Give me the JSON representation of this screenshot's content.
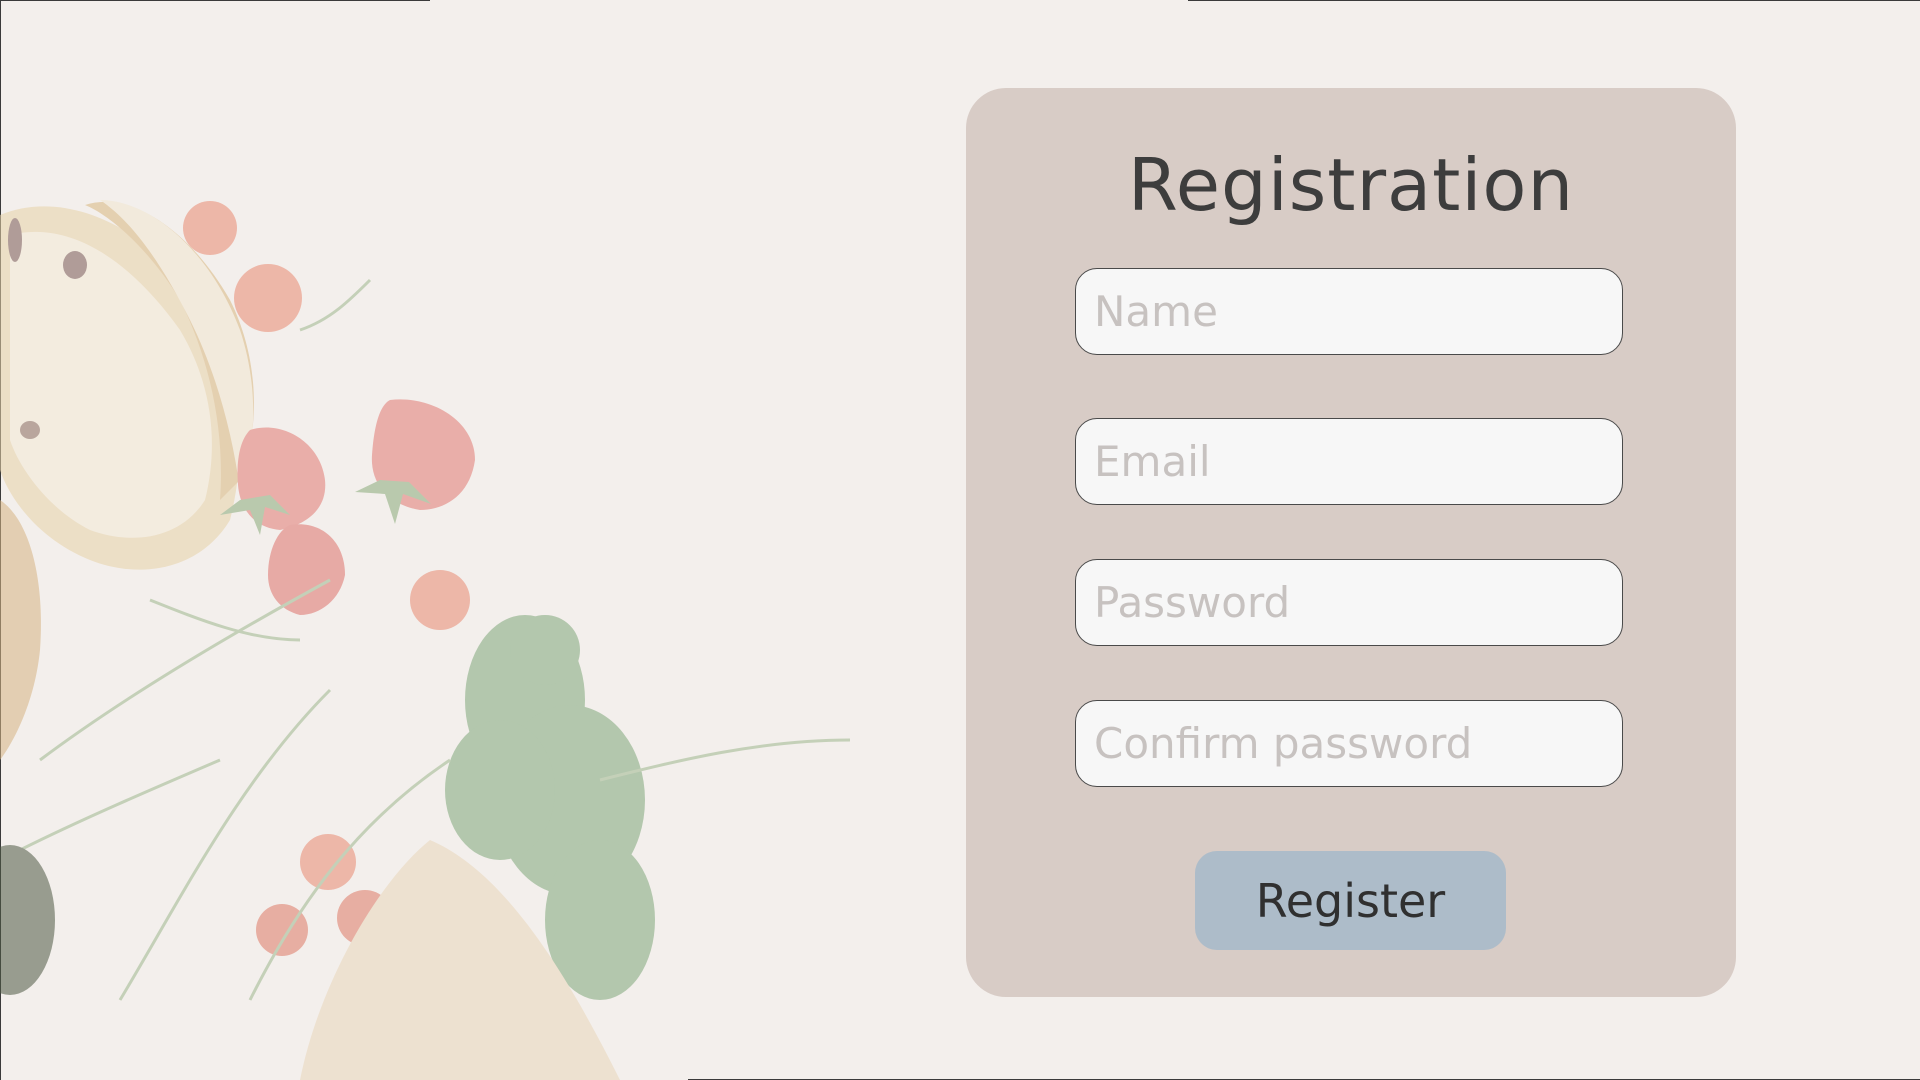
{
  "page": {
    "background_color": "#f3efec",
    "card_color": "#d8ccc6",
    "button_color": "#adbcc9"
  },
  "form": {
    "title": "Registration",
    "fields": {
      "name": {
        "placeholder": "Name",
        "value": ""
      },
      "email": {
        "placeholder": "Email",
        "value": ""
      },
      "password": {
        "placeholder": "Password",
        "value": ""
      },
      "confirm_password": {
        "placeholder": "Confirm password",
        "value": ""
      }
    },
    "submit_label": "Register"
  },
  "background_image": {
    "icon": "food-flatlay-illustration"
  }
}
